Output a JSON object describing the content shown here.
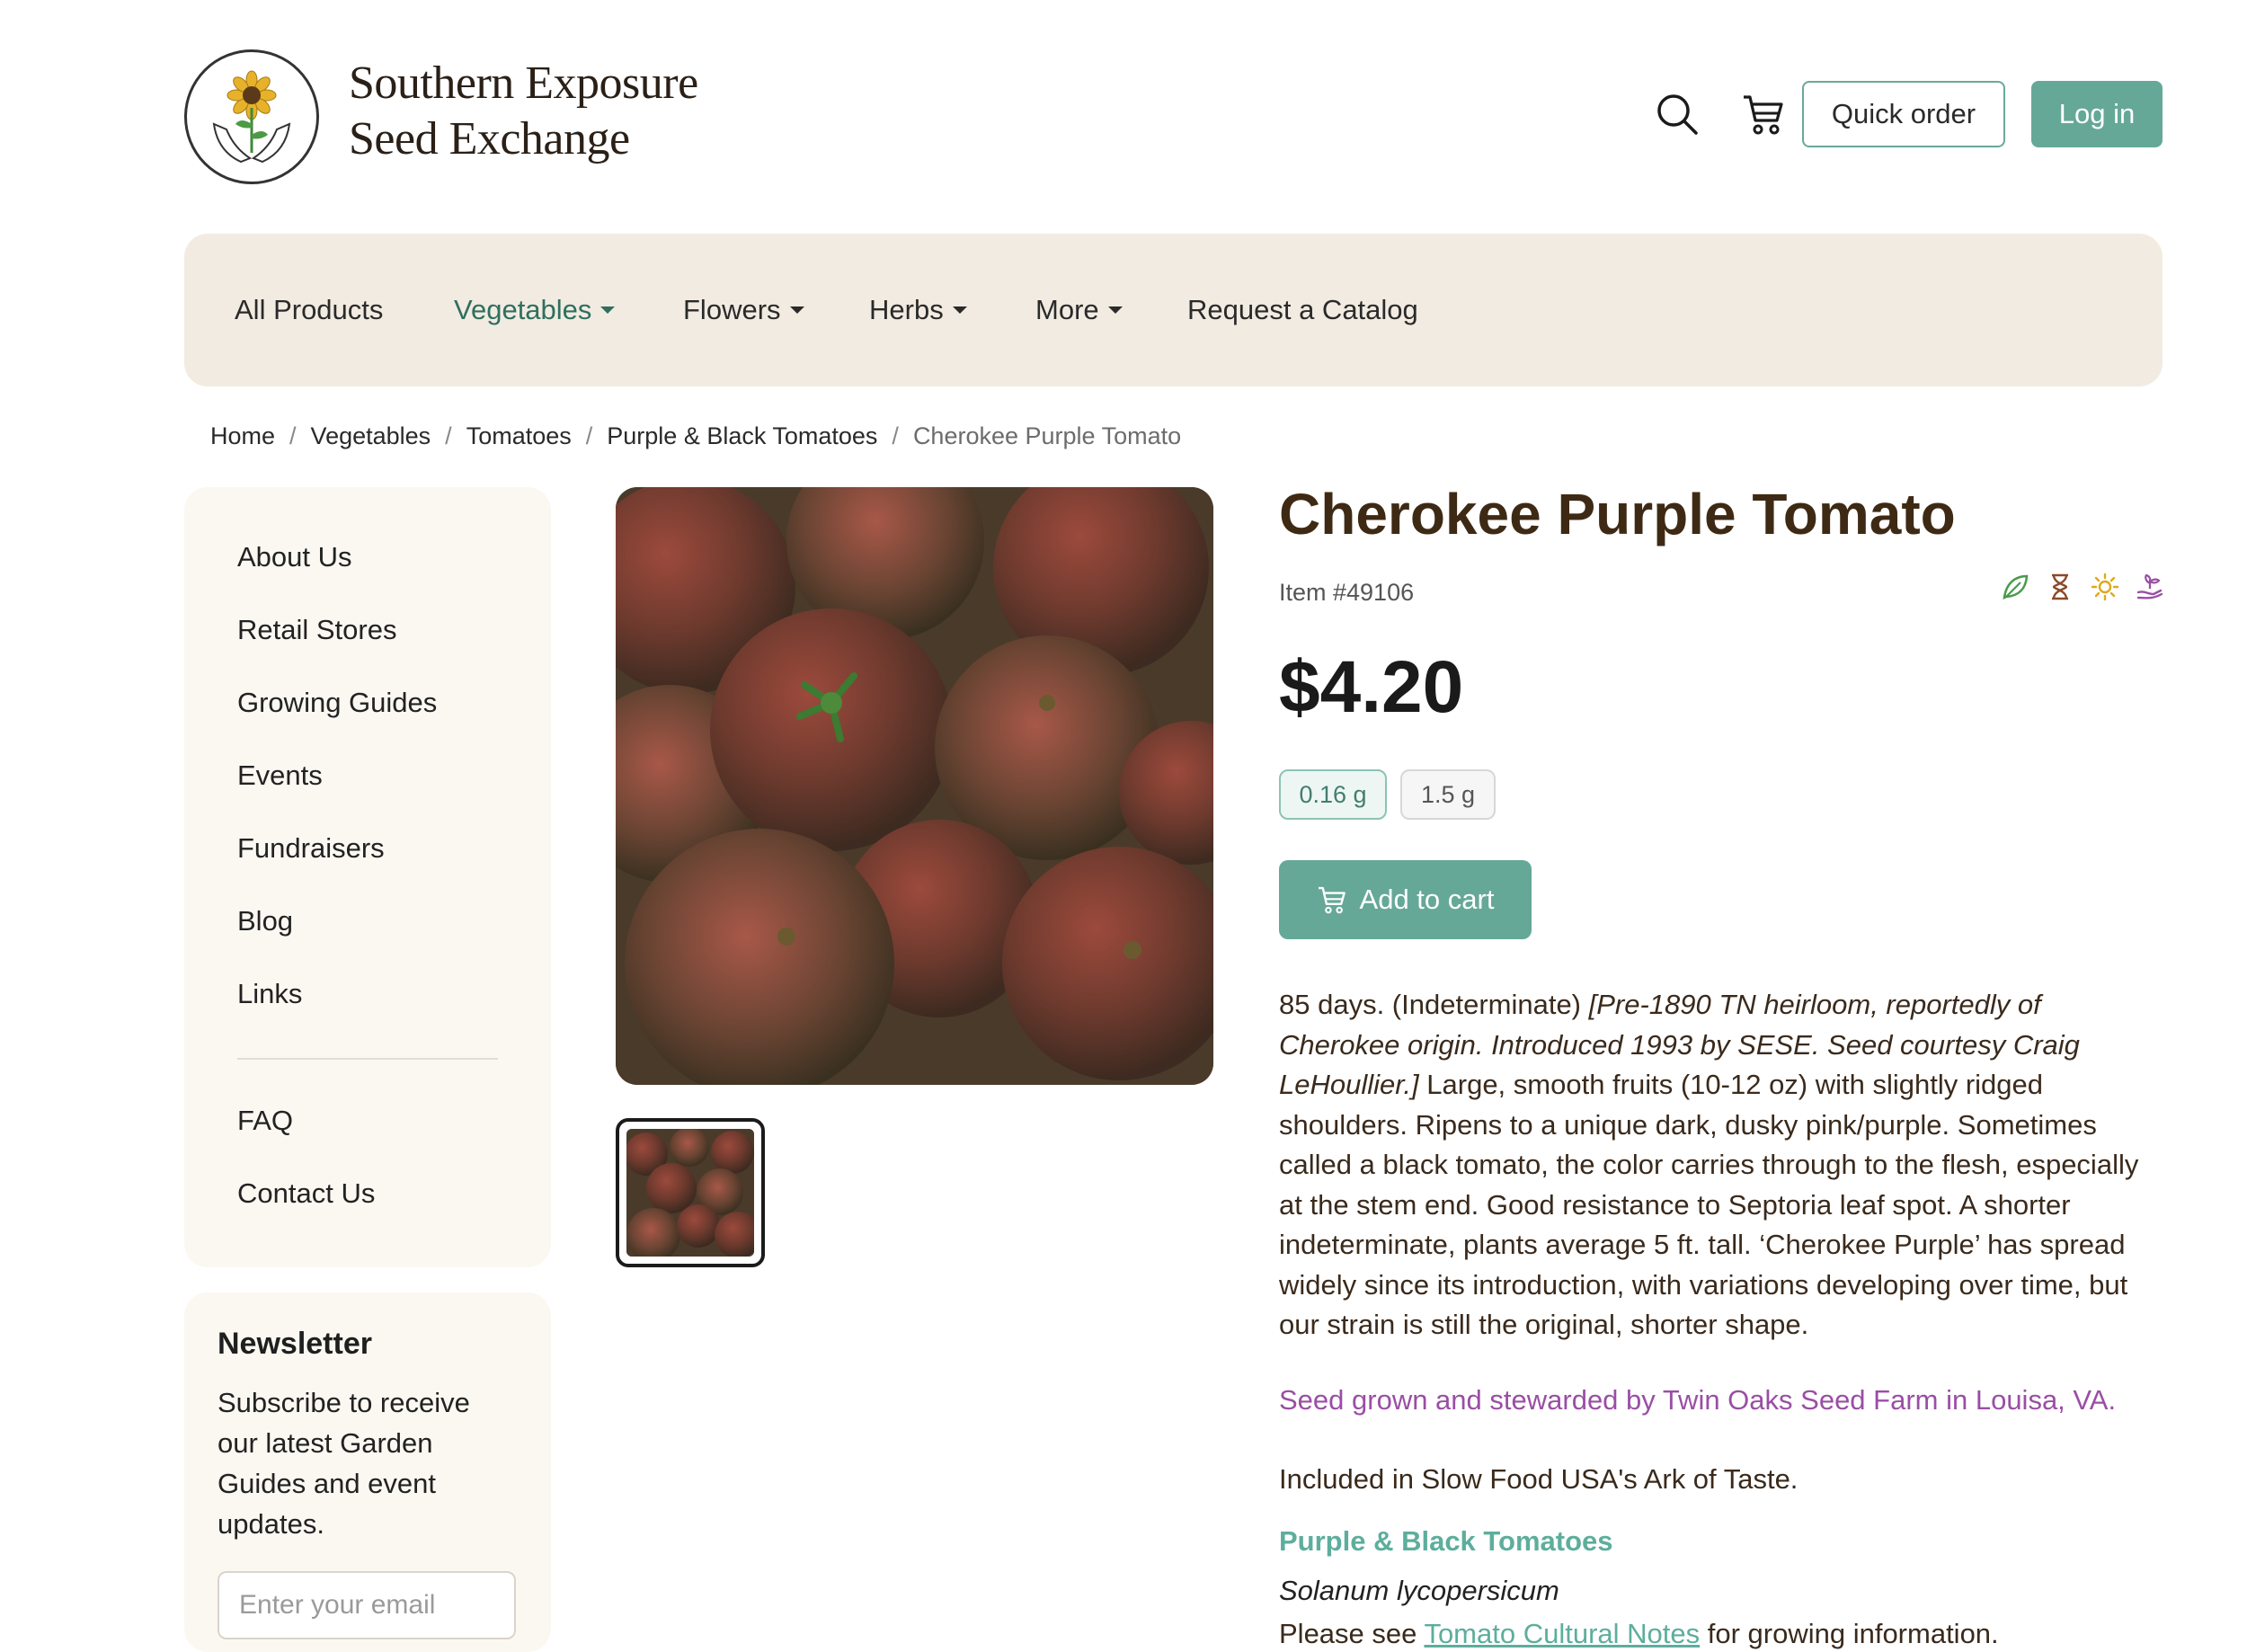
{
  "brand": {
    "line1": "Southern Exposure",
    "line2": "Seed Exchange"
  },
  "header": {
    "quick_order": "Quick order",
    "login": "Log in"
  },
  "nav": {
    "items": [
      {
        "label": "All Products",
        "dropdown": false
      },
      {
        "label": "Vegetables",
        "dropdown": true,
        "active": true
      },
      {
        "label": "Flowers",
        "dropdown": true
      },
      {
        "label": "Herbs",
        "dropdown": true
      },
      {
        "label": "More",
        "dropdown": true
      },
      {
        "label": "Request a Catalog",
        "dropdown": false
      }
    ]
  },
  "breadcrumb": [
    "Home",
    "Vegetables",
    "Tomatoes",
    "Purple & Black Tomatoes",
    "Cherokee Purple Tomato"
  ],
  "sidebar": {
    "links": [
      "About Us",
      "Retail Stores",
      "Growing Guides",
      "Events",
      "Fundraisers",
      "Blog",
      "Links"
    ],
    "links2": [
      "FAQ",
      "Contact Us"
    ]
  },
  "newsletter": {
    "title": "Newsletter",
    "text": "Subscribe to receive our latest Garden Guides and event updates.",
    "placeholder": "Enter your email"
  },
  "product": {
    "title": "Cherokee Purple Tomato",
    "item_no": "Item #49106",
    "price": "$4.20",
    "sizes": [
      "0.16 g",
      "1.5 g"
    ],
    "selected_size": "0.16 g",
    "add_to_cart": "Add to cart",
    "desc_prefix": "85 days. (Indeterminate) ",
    "desc_italic": "[Pre-1890 TN heirloom, reportedly of Cherokee origin. Introduced 1993 by SESE. Seed courtesy Craig LeHoullier.]",
    "desc_body": " Large, smooth fruits (10-12 oz) with slightly ridged shoulders. Ripens to a unique dark, dusky pink/purple. Sometimes called a black tomato, the color carries through to the flesh, especially at the stem end. Good resistance to Septoria leaf spot. A shorter indeterminate, plants average 5 ft. tall. ‘Cherokee Purple’ has spread widely since its introduction, with variations developing over time, but our strain is still the original, shorter shape.",
    "grower": "Seed grown and stewarded by Twin Oaks Seed Farm in Louisa, VA.",
    "ark": "Included in Slow Food USA's Ark of Taste.",
    "category_link": "Purple & Black Tomatoes",
    "latin": "Solanum lycopersicum",
    "see_prefix": "Please see ",
    "see_link": "Tomato Cultural Notes",
    "see_suffix": " for growing information."
  },
  "icons": {
    "search": "search-icon",
    "cart": "cart-icon",
    "attributes": [
      "leaf-icon",
      "hourglass-icon",
      "sun-icon",
      "hand-seedling-icon"
    ]
  },
  "colors": {
    "accent": "#66a898",
    "nav_bg": "#f2ebe1",
    "title": "#3e2a14",
    "grower": "#9a4ea5",
    "link": "#5dae9c"
  }
}
